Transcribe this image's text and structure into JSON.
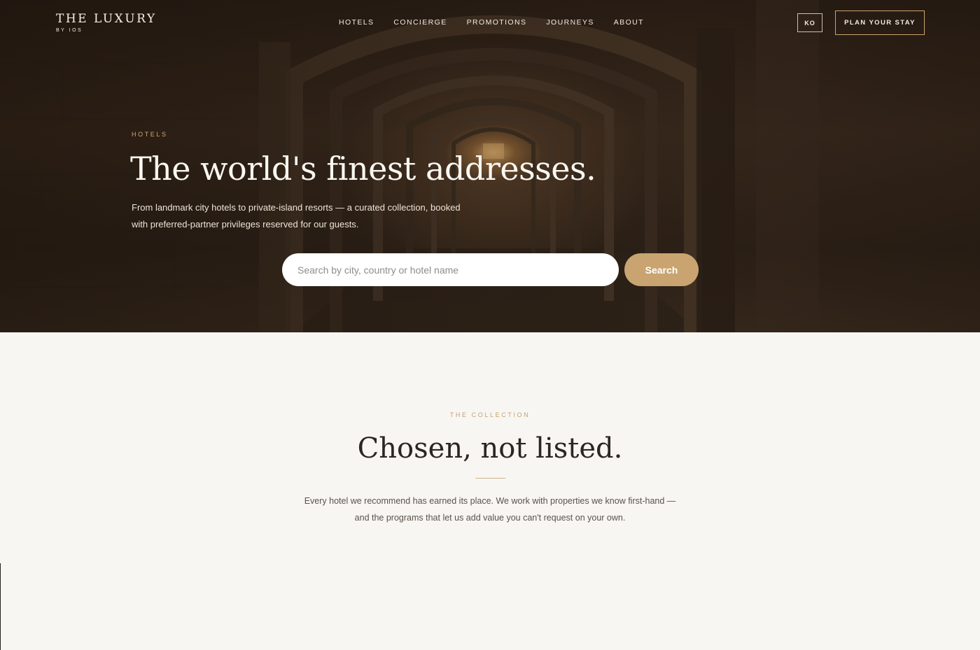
{
  "brand": {
    "name": "THE LUXURY",
    "sub": "BY IOS"
  },
  "nav": {
    "items": [
      "HOTELS",
      "CONCIERGE",
      "PROMOTIONS",
      "JOURNEYS",
      "ABOUT"
    ],
    "lang_label": "KO",
    "cta_label": "PLAN YOUR STAY"
  },
  "hero": {
    "eyebrow": "HOTELS",
    "title": "The world's finest addresses.",
    "text": "From landmark city hotels to private-island resorts — a curated collection, booked with preferred-partner privileges reserved for our guests.",
    "search": {
      "placeholder": "Search by city, country or hotel name",
      "value": "",
      "button_label": "Search"
    }
  },
  "collection": {
    "eyebrow": "THE COLLECTION",
    "title": "Chosen, not listed.",
    "text": "Every hotel we recommend has earned its place. We work with properties we know first-hand — and the programs that let us add value you can't request on your own."
  },
  "colors": {
    "accent": "#c9a470",
    "hero_bg": "#2e2218",
    "page_bg": "#f8f6f2",
    "heading": "#2b2622"
  }
}
